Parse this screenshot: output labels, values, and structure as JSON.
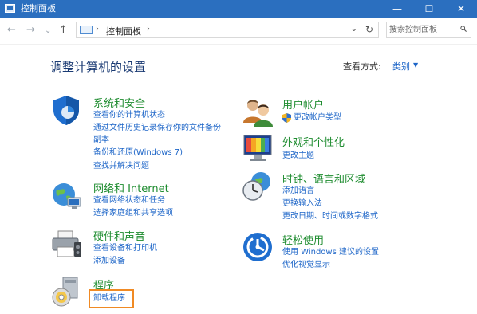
{
  "window": {
    "title": "控制面板",
    "minimize": "—",
    "maximize": "☐",
    "close": "✕"
  },
  "nav": {
    "back": "←",
    "forward": "→",
    "recent": "⌄",
    "up": "↑",
    "breadcrumb": "控制面板",
    "search_placeholder": "搜索控制面板"
  },
  "header": {
    "title": "调整计算机的设置",
    "view_by_label": "查看方式:",
    "view_by_value": "类别"
  },
  "categories": [
    {
      "title": "系统和安全",
      "links": [
        "查看你的计算机状态",
        "通过文件历史记录保存你的文件备份",
        "副本",
        "备份和还原(Windows 7)",
        "查找并解决问题"
      ]
    },
    {
      "title": "网络和 Internet",
      "links": [
        "查看网络状态和任务",
        "选择家庭组和共享选项"
      ]
    },
    {
      "title": "硬件和声音",
      "links": [
        "查看设备和打印机",
        "添加设备"
      ]
    },
    {
      "title": "程序",
      "links": [
        "卸载程序"
      ]
    },
    {
      "title": "用户帐户",
      "links": [
        "更改帐户类型"
      ]
    },
    {
      "title": "外观和个性化",
      "links": [
        "更改主题"
      ]
    },
    {
      "title": "时钟、语言和区域",
      "links": [
        "添加语言",
        "更换输入法",
        "更改日期、时间或数字格式"
      ]
    },
    {
      "title": "轻松使用",
      "links": [
        "使用 Windows 建议的设置",
        "优化视觉显示"
      ]
    }
  ],
  "colors": {
    "titlebar": "#2b6fbf",
    "category_title": "#1e8c2f",
    "link": "#1e66c8",
    "highlight": "#f08a24"
  }
}
